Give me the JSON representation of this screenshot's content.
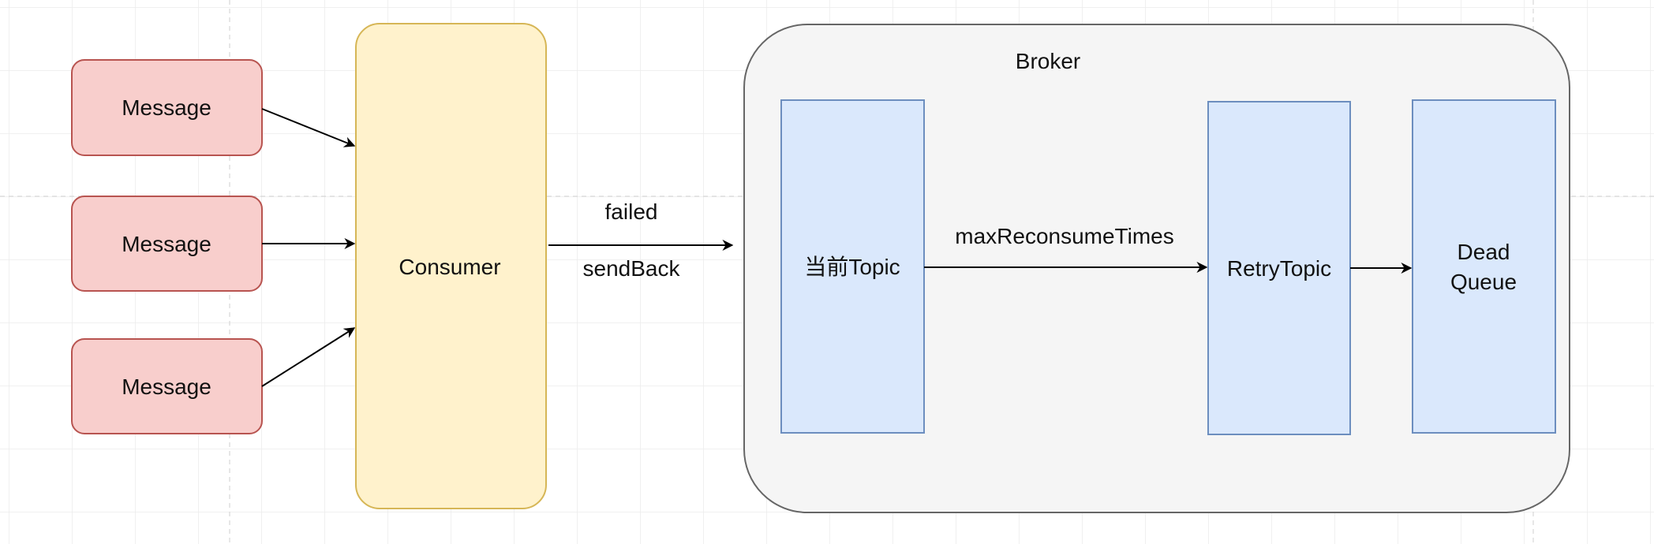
{
  "messages": [
    {
      "label": "Message"
    },
    {
      "label": "Message"
    },
    {
      "label": "Message"
    }
  ],
  "consumer": {
    "label": "Consumer"
  },
  "send_back_edge": {
    "label_top": "failed",
    "label_bottom": "sendBack"
  },
  "broker": {
    "label": "Broker",
    "current_topic": "当前Topic",
    "retry_edge_label": "maxReconsumeTimes",
    "retry_topic": "RetryTopic",
    "dead_queue": {
      "line1": "Dead",
      "line2": "Queue"
    }
  },
  "colors": {
    "message_fill": "#f8cecc",
    "message_stroke": "#b85450",
    "consumer_fill": "#fff2cc",
    "consumer_stroke": "#d6b656",
    "topic_fill": "#dae8fc",
    "topic_stroke": "#6c8ebf",
    "broker_fill": "#f5f5f5",
    "broker_stroke": "#666666"
  }
}
